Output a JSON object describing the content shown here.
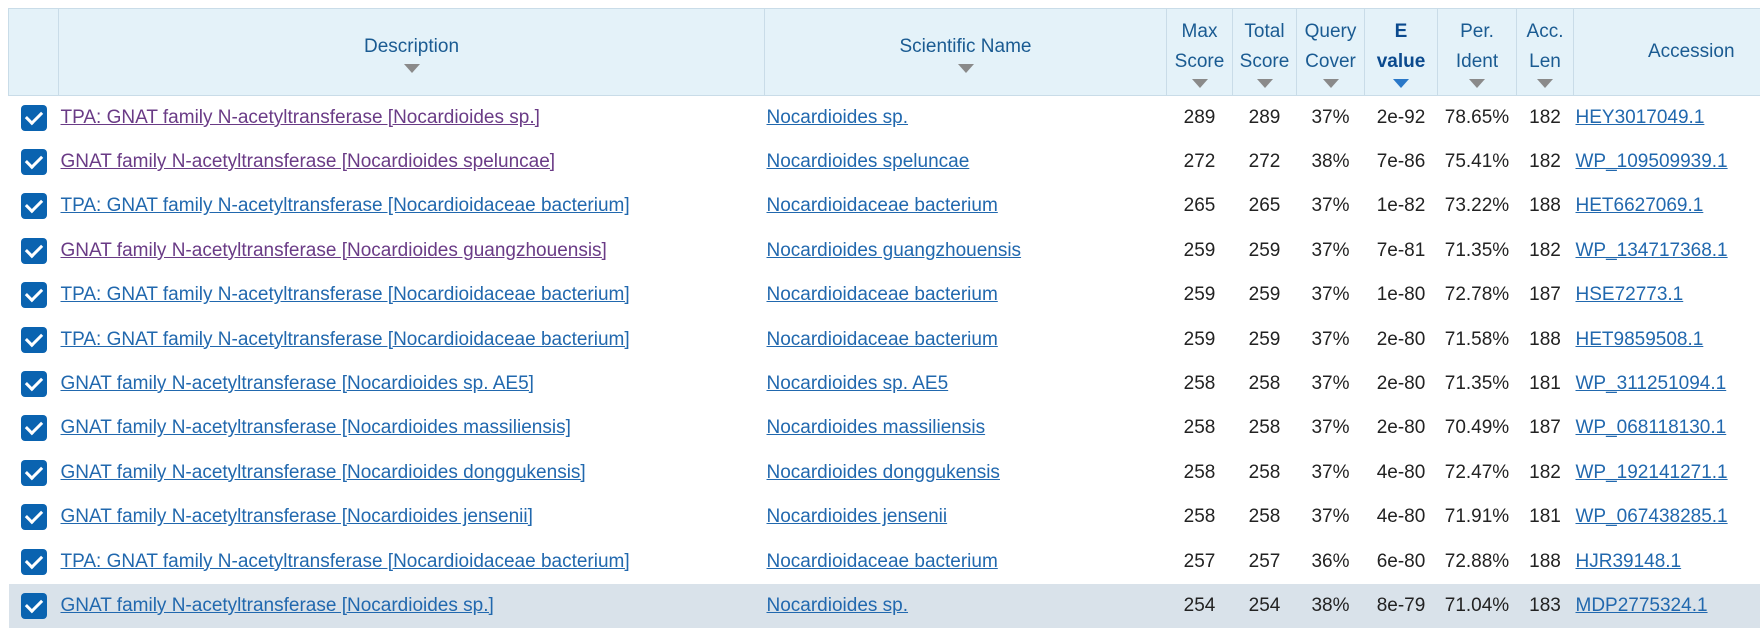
{
  "columns": {
    "description": "Description",
    "scientific_name": "Scientific Name",
    "max_score": [
      "Max",
      "Score"
    ],
    "total_score": [
      "Total",
      "Score"
    ],
    "query_cover": [
      "Query",
      "Cover"
    ],
    "e_value": [
      "E",
      "value"
    ],
    "per_ident": [
      "Per.",
      "Ident"
    ],
    "acc_len": [
      "Acc.",
      "Len"
    ],
    "accession": "Accession"
  },
  "colors": {
    "header_bg": "#e4f2f9",
    "link": "#2168ae",
    "visited_link": "#6a3b86",
    "checkbox": "#0a63b0",
    "selected_row": "#d9e2ea"
  },
  "rows": [
    {
      "description": "TPA: GNAT family N-acetyltransferase [Nocardioides sp.]",
      "sci": "Nocardioides sp.",
      "max": "289",
      "total": "289",
      "cover": "37%",
      "evalue": "2e-92",
      "ident": "78.65%",
      "len": "182",
      "acc": "HEY3017049.1",
      "visited": true
    },
    {
      "description": "GNAT family N-acetyltransferase [Nocardioides speluncae]",
      "sci": "Nocardioides speluncae",
      "max": "272",
      "total": "272",
      "cover": "38%",
      "evalue": "7e-86",
      "ident": "75.41%",
      "len": "182",
      "acc": "WP_109509939.1",
      "visited": true
    },
    {
      "description": "TPA: GNAT family N-acetyltransferase [Nocardioidaceae bacterium]",
      "sci": "Nocardioidaceae bacterium",
      "max": "265",
      "total": "265",
      "cover": "37%",
      "evalue": "1e-82",
      "ident": "73.22%",
      "len": "188",
      "acc": "HET6627069.1",
      "visited": false
    },
    {
      "description": "GNAT family N-acetyltransferase [Nocardioides guangzhouensis]",
      "sci": "Nocardioides guangzhouensis",
      "max": "259",
      "total": "259",
      "cover": "37%",
      "evalue": "7e-81",
      "ident": "71.35%",
      "len": "182",
      "acc": "WP_134717368.1",
      "visited": true
    },
    {
      "description": "TPA: GNAT family N-acetyltransferase [Nocardioidaceae bacterium]",
      "sci": "Nocardioidaceae bacterium",
      "max": "259",
      "total": "259",
      "cover": "37%",
      "evalue": "1e-80",
      "ident": "72.78%",
      "len": "187",
      "acc": "HSE72773.1",
      "visited": false
    },
    {
      "description": "TPA: GNAT family N-acetyltransferase [Nocardioidaceae bacterium]",
      "sci": "Nocardioidaceae bacterium",
      "max": "259",
      "total": "259",
      "cover": "37%",
      "evalue": "2e-80",
      "ident": "71.58%",
      "len": "188",
      "acc": "HET9859508.1",
      "visited": false
    },
    {
      "description": "GNAT family N-acetyltransferase [Nocardioides sp. AE5]",
      "sci": "Nocardioides sp. AE5",
      "max": "258",
      "total": "258",
      "cover": "37%",
      "evalue": "2e-80",
      "ident": "71.35%",
      "len": "181",
      "acc": "WP_311251094.1",
      "visited": false
    },
    {
      "description": "GNAT family N-acetyltransferase [Nocardioides massiliensis]",
      "sci": "Nocardioides massiliensis",
      "max": "258",
      "total": "258",
      "cover": "37%",
      "evalue": "2e-80",
      "ident": "70.49%",
      "len": "187",
      "acc": "WP_068118130.1",
      "visited": false
    },
    {
      "description": "GNAT family N-acetyltransferase [Nocardioides donggukensis]",
      "sci": "Nocardioides donggukensis",
      "max": "258",
      "total": "258",
      "cover": "37%",
      "evalue": "4e-80",
      "ident": "72.47%",
      "len": "182",
      "acc": "WP_192141271.1",
      "visited": false
    },
    {
      "description": "GNAT family N-acetyltransferase [Nocardioides jensenii]",
      "sci": "Nocardioides jensenii",
      "max": "258",
      "total": "258",
      "cover": "37%",
      "evalue": "4e-80",
      "ident": "71.91%",
      "len": "181",
      "acc": "WP_067438285.1",
      "visited": false
    },
    {
      "description": "TPA: GNAT family N-acetyltransferase [Nocardioidaceae bacterium]",
      "sci": "Nocardioidaceae bacterium",
      "max": "257",
      "total": "257",
      "cover": "36%",
      "evalue": "6e-80",
      "ident": "72.88%",
      "len": "188",
      "acc": "HJR39148.1",
      "visited": false
    },
    {
      "description": "GNAT family N-acetyltransferase [Nocardioides sp.]",
      "sci": "Nocardioides sp.",
      "max": "254",
      "total": "254",
      "cover": "38%",
      "evalue": "8e-79",
      "ident": "71.04%",
      "len": "183",
      "acc": "MDP2775324.1",
      "visited": false
    }
  ]
}
